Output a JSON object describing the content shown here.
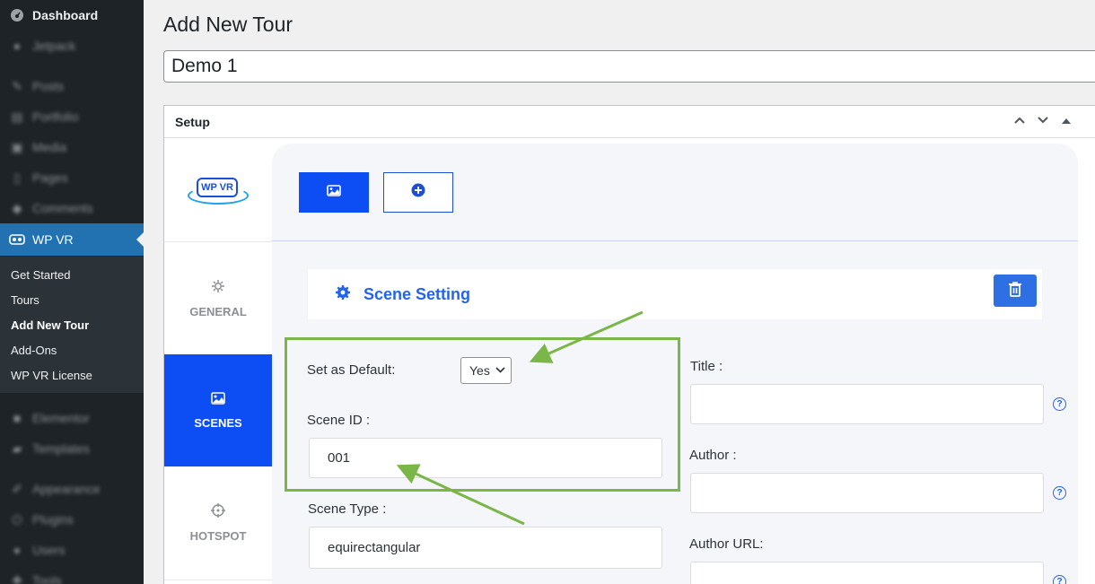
{
  "sidebar": {
    "items": [
      {
        "label": "Dashboard",
        "icon": "dashboard-icon"
      },
      {
        "label": "Jetpack",
        "icon": "jetpack-icon"
      },
      {
        "label": "Posts",
        "icon": "pin-icon"
      },
      {
        "label": "Portfolio",
        "icon": "portfolio-icon"
      },
      {
        "label": "Media",
        "icon": "media-icon"
      },
      {
        "label": "Pages",
        "icon": "page-icon"
      },
      {
        "label": "Comments",
        "icon": "comment-icon"
      },
      {
        "label": "WP VR",
        "icon": "vr-icon"
      },
      {
        "label": "Elementor",
        "icon": "elementor-icon"
      },
      {
        "label": "Templates",
        "icon": "folder-icon"
      },
      {
        "label": "Appearance",
        "icon": "brush-icon"
      },
      {
        "label": "Plugins",
        "icon": "plugin-icon"
      },
      {
        "label": "Users",
        "icon": "user-icon"
      },
      {
        "label": "Tools",
        "icon": "wrench-icon"
      }
    ],
    "submenu": [
      "Get Started",
      "Tours",
      "Add New Tour",
      "Add-Ons",
      "WP VR License"
    ]
  },
  "page": {
    "title": "Add New Tour",
    "tour_title_value": "Demo 1"
  },
  "setup": {
    "heading": "Setup"
  },
  "plugin": {
    "logo_text": "WP VR",
    "tabs": [
      "GENERAL",
      "SCENES",
      "HOTSPOT"
    ],
    "active_tab": "SCENES",
    "scene_setting_title": "Scene Setting",
    "fields": {
      "set_default_label": "Set as Default:",
      "set_default_value": "Yes",
      "scene_id_label": "Scene ID :",
      "scene_id_value": "001",
      "scene_type_label": "Scene Type :",
      "scene_type_value": "equirectangular",
      "title_label": "Title :",
      "title_value": "",
      "author_label": "Author :",
      "author_value": "",
      "author_url_label": "Author URL:",
      "author_url_value": "",
      "help_glyph": "?"
    }
  },
  "colors": {
    "accent": "#0c4df4",
    "wp_admin_blue": "#2271b1",
    "highlight_green": "#7ab648"
  }
}
